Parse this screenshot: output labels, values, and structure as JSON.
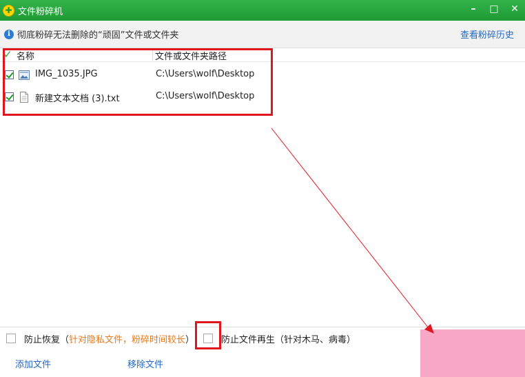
{
  "window": {
    "title": "文件粉碎机",
    "controls": {
      "minimize": "–",
      "maximize": "□",
      "close": "✕"
    }
  },
  "info": {
    "text": "彻底粉碎无法删除的“顽固”文件或文件夹",
    "history_link": "查看粉碎历史"
  },
  "table": {
    "headers": {
      "name": "名称",
      "path": "文件或文件夹路径"
    },
    "rows": [
      {
        "name": "IMG_1035.JPG",
        "path": "C:\\Users\\wolf\\Desktop",
        "checked": true,
        "icon": "image-file-icon"
      },
      {
        "name": "新建文本文档 (3).txt",
        "path": "C:\\Users\\wolf\\Desktop",
        "checked": true,
        "icon": "text-file-icon"
      }
    ]
  },
  "options": {
    "prevent_recovery": "防止恢复（",
    "prevent_recovery_note": "针对隐私文件，粉碎时间较长",
    "prevent_recovery_close": "）",
    "prevent_regen": "防止文件再生（针对木马、病毒）"
  },
  "bottom": {
    "add_file": "添加文件",
    "remove_file": "移除文件"
  },
  "colors": {
    "titlebar": "#22a03b",
    "annotation_red": "#e0161e",
    "link_blue": "#2268c4",
    "note_orange": "#e67817"
  }
}
